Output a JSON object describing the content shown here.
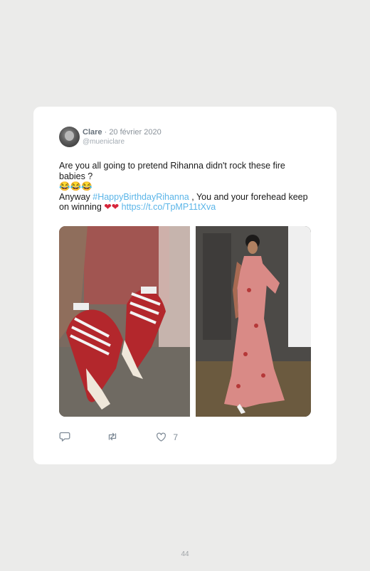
{
  "tweet": {
    "author_name": "Clare",
    "separator": " · ",
    "date": "20 février 2020",
    "handle": "@mueniclare",
    "text_line1": "Are you all going to pretend Rihanna didn't rock these fire babies ?",
    "emoji": "😂😂😂",
    "text_anyway": "Anyway ",
    "hashtag": "#HappyBirthdayRihanna",
    "text_after_hashtag": " , You and your forehead keep on winning ",
    "hearts": "❤❤",
    "url": " https://t.co/TpMP11tXva",
    "like_count": "7"
  },
  "icons": {
    "reply": "reply-icon",
    "retweet": "retweet-icon",
    "like": "heart-icon"
  },
  "colors": {
    "background": "#ebebea",
    "card": "#ffffff",
    "link": "#5bb5e8",
    "action_icon": "#7e8a96"
  },
  "page": {
    "number": "44"
  }
}
